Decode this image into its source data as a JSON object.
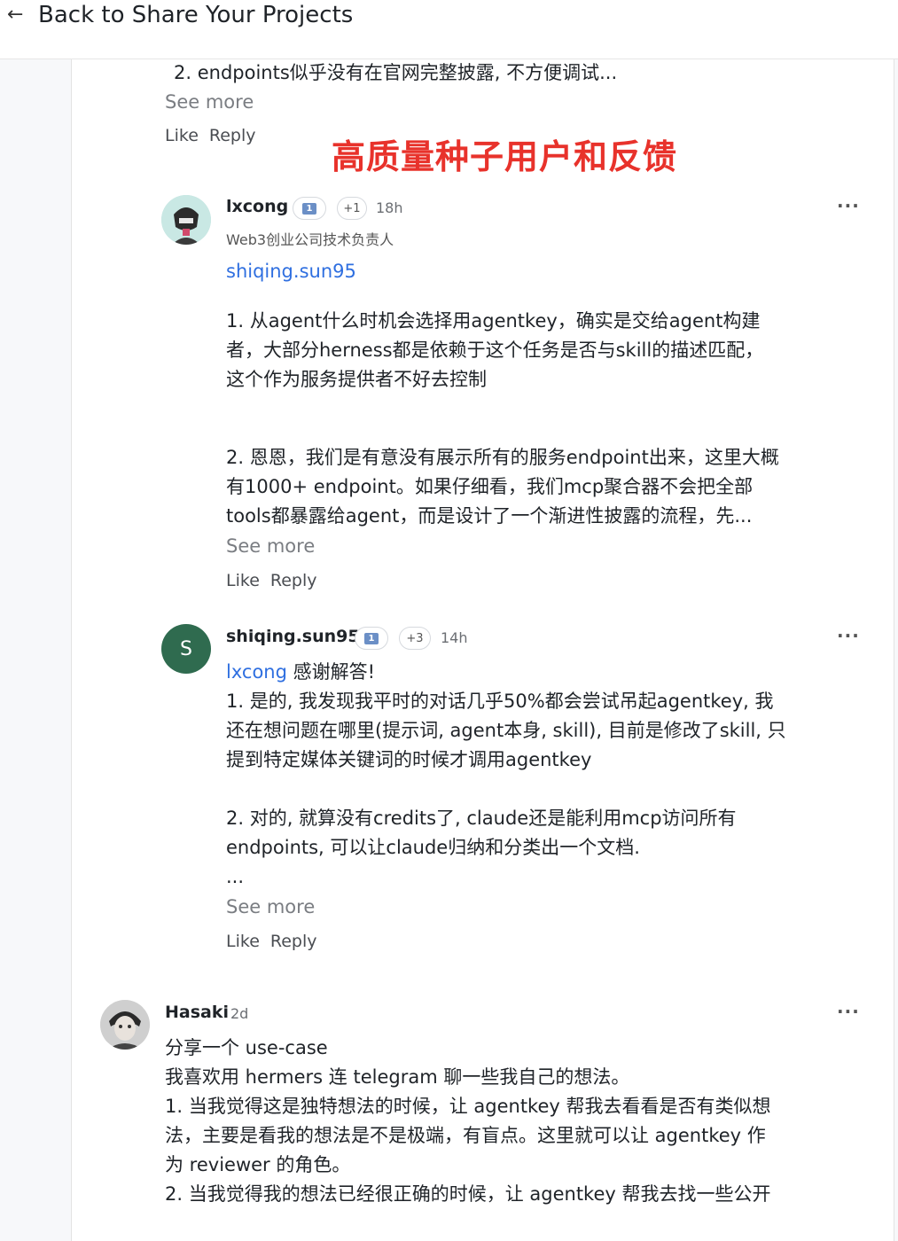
{
  "header": {
    "back_icon": "arrow-left-icon",
    "title": "Back to Share Your Projects"
  },
  "prev_comment": {
    "line": "2. endpoints似乎没有在官网完整披露, 不方便调试...",
    "see_more": "See more",
    "like": "Like",
    "reply": "Reply"
  },
  "annotation": {
    "text": "高质量种子用户和反馈",
    "color": "#e8322b"
  },
  "reply1": {
    "username": "lxcong",
    "badge_plus": "+1",
    "time": "18h",
    "subtitle": "Web3创业公司技术负责人",
    "mention": "shiqing.sun95",
    "para1": [
      "1. 从agent什么时机会选择用agentkey，确实是交给agent构建",
      "者，大部分herness都是依赖于这个任务是否与skill的描述匹配，",
      "这个作为服务提供者不好去控制"
    ],
    "para2": [
      "2. 恩恩，我们是有意没有展示所有的服务endpoint出来，这里大概",
      "有1000+ endpoint。如果仔细看，我们mcp聚合器不会把全部",
      "tools都暴露给agent，而是设计了一个渐进性披露的流程，先..."
    ],
    "see_more": "See more",
    "like": "Like",
    "reply": "Reply"
  },
  "reply2": {
    "avatar_letter": "S",
    "avatar_color": "#2f6b4f",
    "username": "shiqing.sun95",
    "badge_plus": "+3",
    "time": "14h",
    "mention": "lxcong",
    "mention_text": " 感谢解答!",
    "lines": [
      "1. 是的, 我发现我平时的对话几乎50%都会尝试吊起agentkey, 我",
      "还在想问题在哪里(提示词, agent本身, skill), 目前是修改了skill, 只",
      "提到特定媒体关键词的时候才调用agentkey"
    ],
    "lines2": [
      "2. 对的, 就算没有credits了, claude还是能利用mcp访问所有",
      "endpoints, 可以让claude归纳和分类出一个文档.",
      "..."
    ],
    "see_more": "See more",
    "like": "Like",
    "reply": "Reply"
  },
  "comment3": {
    "username": "Hasaki",
    "time": "2d",
    "lines": [
      "分享一个 use-case",
      "我喜欢用 hermers 连 telegram 聊一些我自己的想法。",
      "1. 当我觉得这是独特想法的时候，让 agentkey 帮我去看看是否有类似想",
      "法，主要是看我的想法是不是极端，有盲点。这里就可以让 agentkey 作",
      "为 reviewer 的角色。",
      "2. 当我觉得我的想法已经很正确的时候，让 agentkey 帮我去找一些公开"
    ]
  },
  "icons": {
    "more": "more-horizontal-icon",
    "rank_badge": "rank-badge-icon",
    "rank_value": "1"
  },
  "more_glyph": "···"
}
